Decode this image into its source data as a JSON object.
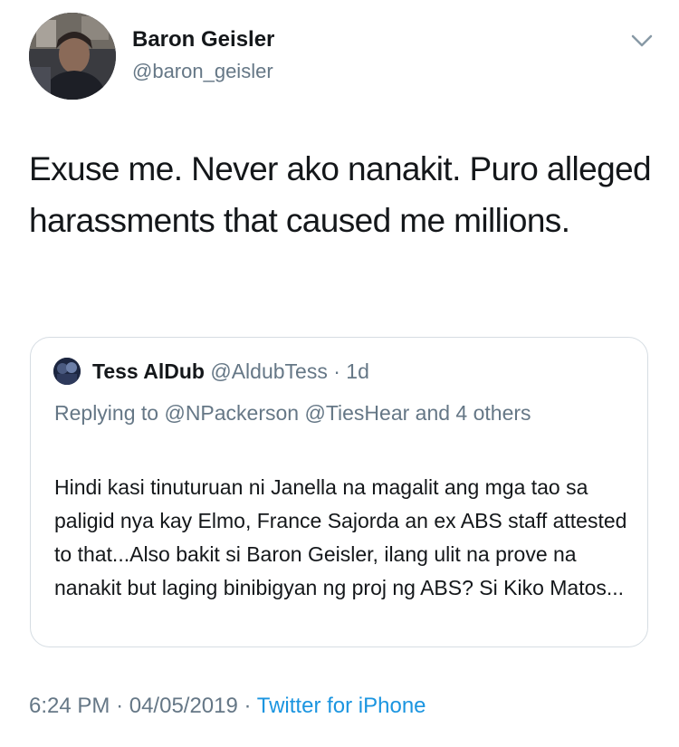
{
  "author": {
    "display_name": "Baron Geisler",
    "handle": "@baron_geisler"
  },
  "header_icons": {
    "menu": "chevron-down-icon"
  },
  "tweet": {
    "text": "Exuse me. Never ako nanakit. Puro alleged harassments that caused me millions."
  },
  "quoted_tweet": {
    "display_name": "Tess AlDub",
    "handle": "@AldubTess",
    "separator": "·",
    "age": "1d",
    "replying_prefix": "Replying to",
    "replying_mentions": "@NPackerson @TiesHear",
    "replying_suffix": "and 4 others",
    "text": "Hindi kasi tinuturuan ni Janella na magalit ang mga tao sa paligid nya kay Elmo, France Sajorda an ex ABS staff attested to that...Also bakit si Baron Geisler, ilang ulit na prove na nanakit but laging binibigyan ng proj ng ABS? Si Kiko Matos..."
  },
  "footer": {
    "time": "6:24 PM",
    "separator1": "·",
    "date": "04/05/2019",
    "separator2": "·",
    "source": "Twitter for iPhone"
  },
  "colors": {
    "text_primary": "#14171a",
    "text_secondary": "#657786",
    "link": "#1b95e0",
    "border": "#d6dde3"
  }
}
